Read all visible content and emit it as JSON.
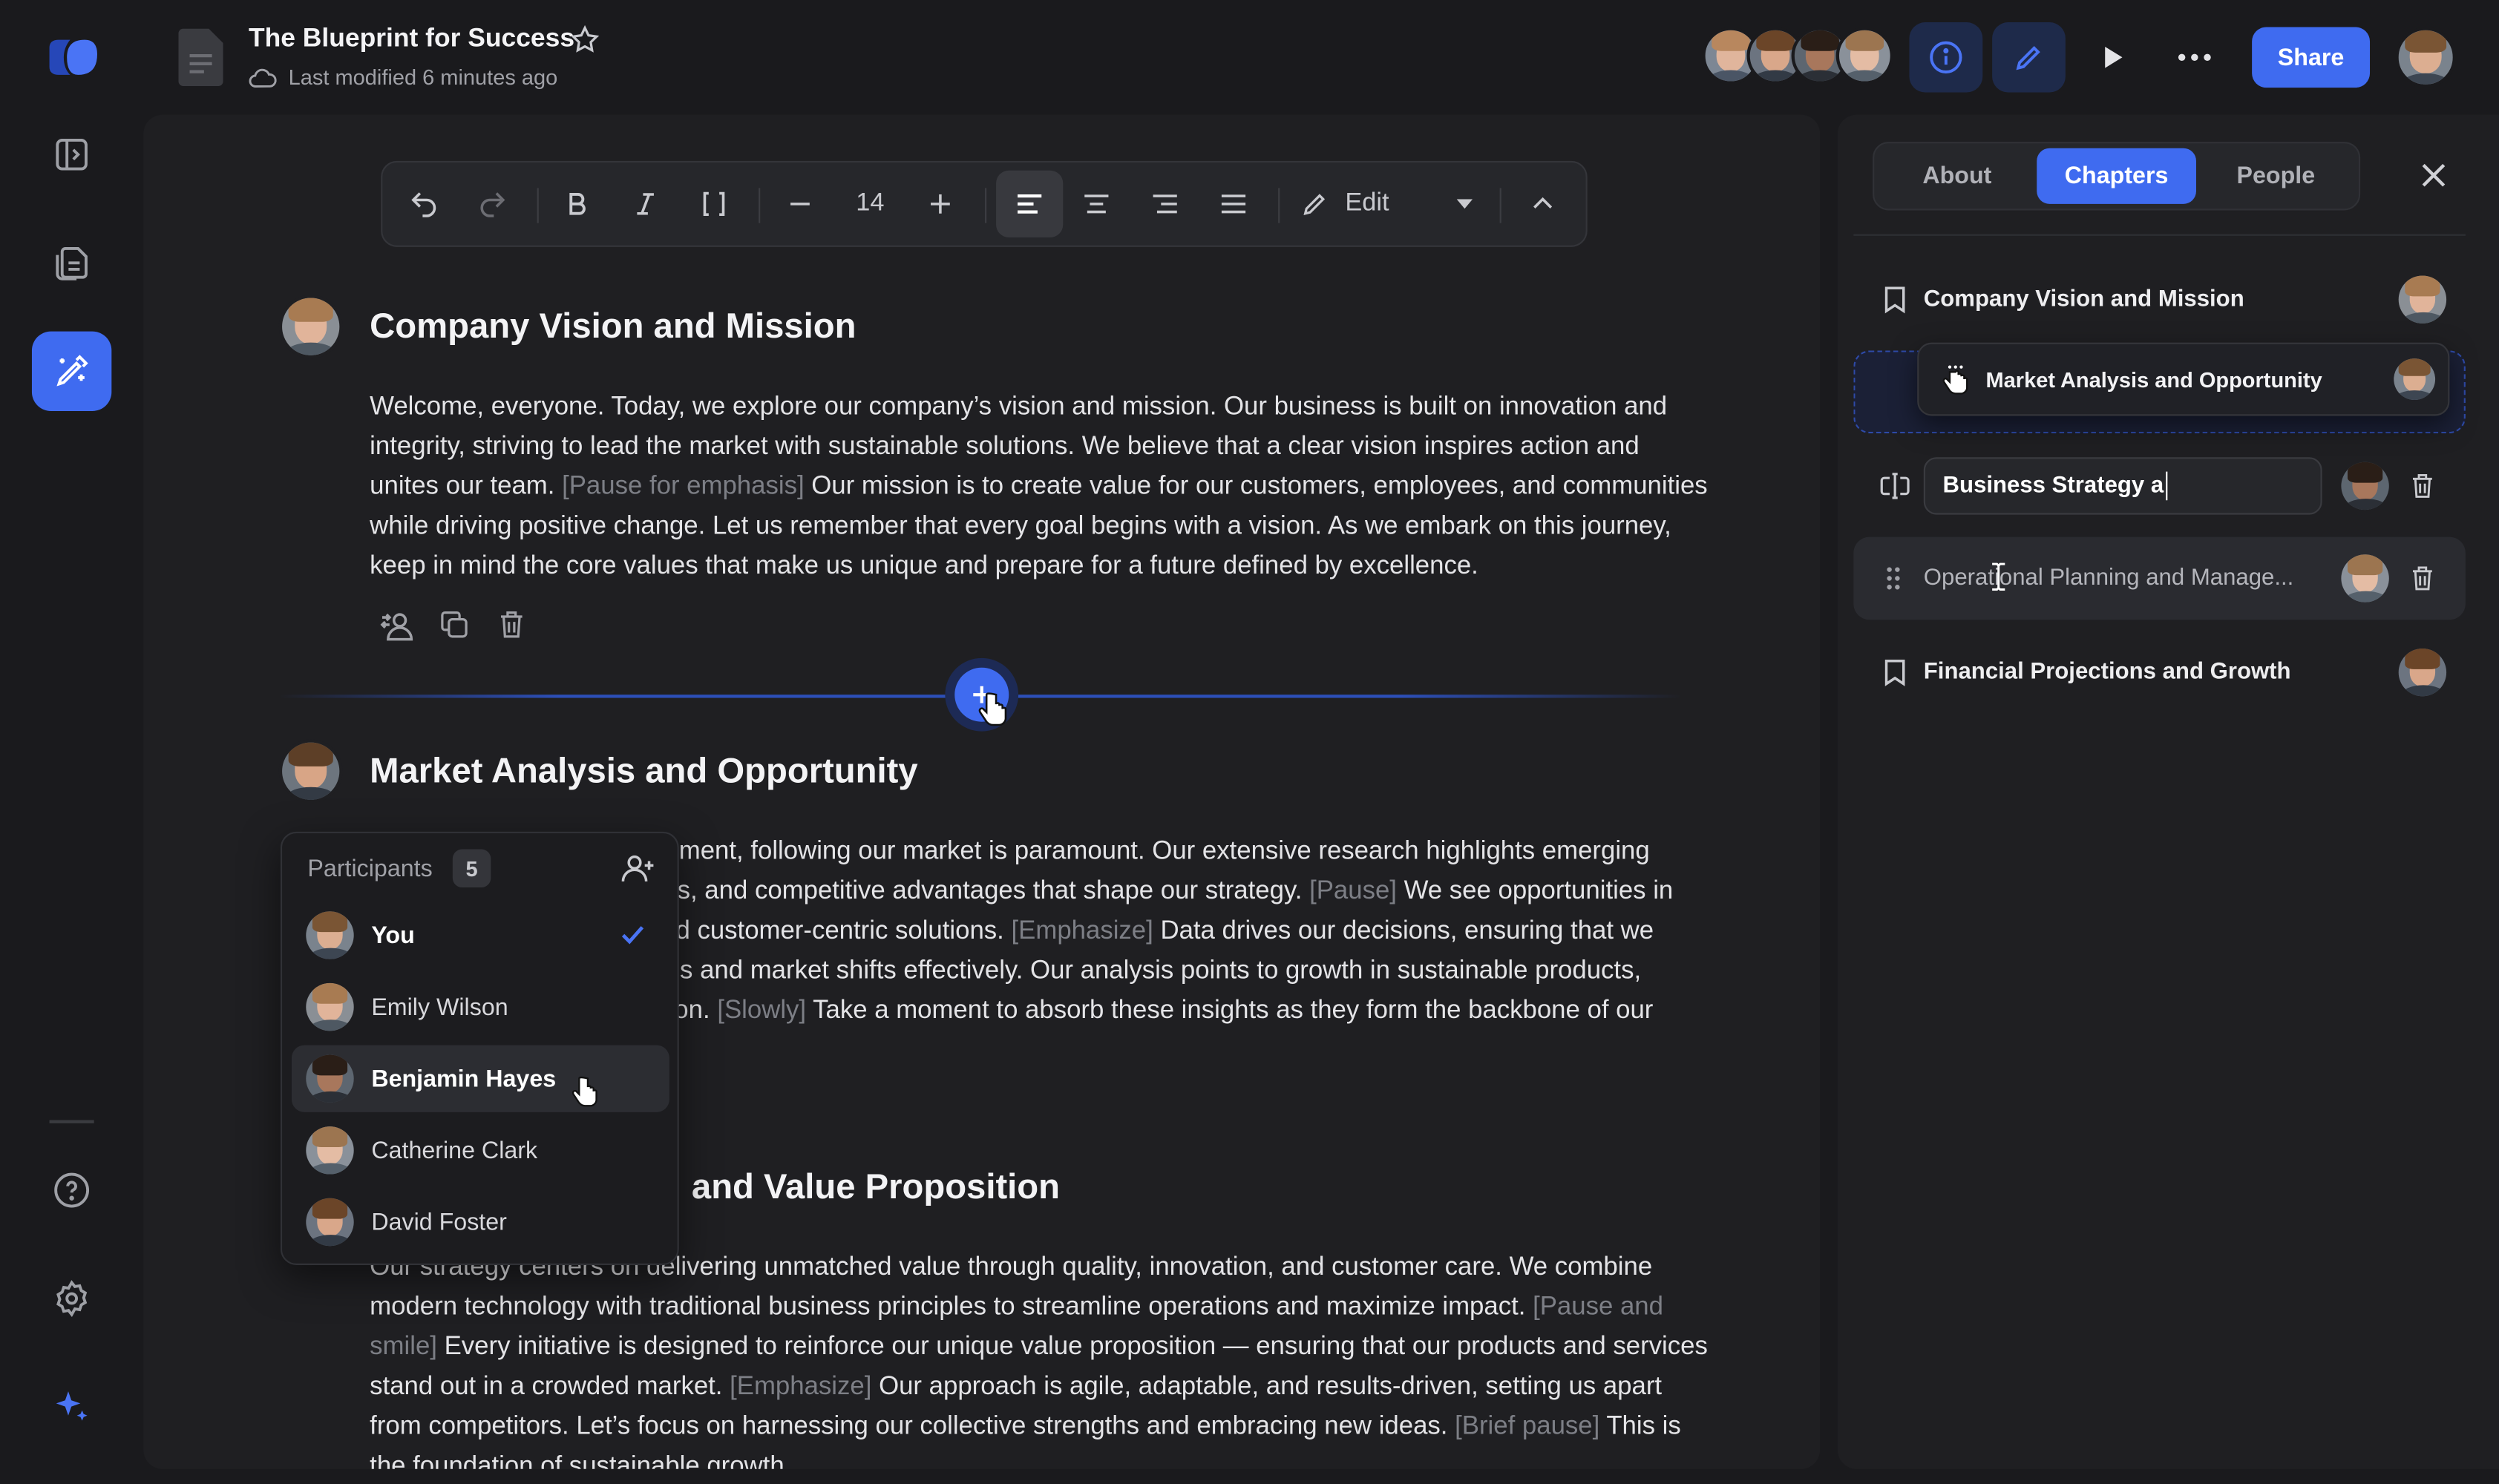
{
  "app": {
    "doc_title": "The Blueprint for Success",
    "last_modified": "Last modified 6 minutes ago",
    "share_label": "Share"
  },
  "toolbar": {
    "font_size": "14",
    "mode_label": "Edit"
  },
  "sections": [
    {
      "title": "Company Vision and Mission",
      "body": [
        {
          "t": "Welcome, everyone. Today, we explore our company’s vision and mission. Our business is built on innovation and integrity, striving to lead the market with sustainable solutions. We believe that a clear vision inspires action and unites our team. "
        },
        {
          "t": "[Pause for emphasis]",
          "cue": true
        },
        {
          "t": " Our mission is to create value for our customers, employees, and communities while driving positive change. Let us remember that every goal begins with a vision. As we embark on this journey, keep in mind the core values that make us unique and prepare for a future defined by excellence."
        }
      ]
    },
    {
      "title": "Market Analysis and Opportunity",
      "body_lines": [
        [
          {
            "t": "ment, following our market is paramount. Our extensive research highlights emerging"
          }
        ],
        [
          {
            "t": "s, and competitive advantages that shape our strategy. "
          },
          {
            "t": "[Pause]",
            "cue": true
          },
          {
            "t": " We see opportunities in"
          }
        ],
        [
          {
            "t": "d customer-centric solutions. "
          },
          {
            "t": "[Emphasize]",
            "cue": true
          },
          {
            "t": " Data drives our decisions, ensuring that we"
          }
        ],
        [
          {
            "t": "ls and market shifts effectively. Our analysis points to growth in sustainable products,"
          }
        ],
        [
          {
            "t": "on. "
          },
          {
            "t": "[Slowly]",
            "cue": true
          },
          {
            "t": " Take a moment to absorb these insights as they form the backbone of our"
          }
        ]
      ]
    },
    {
      "title": "and Value Proposition",
      "body_top_partial": "Our strategy centers on delivering unmatched value through quality, innovation, and customer care. We combine",
      "body": [
        {
          "t": "modern technology with traditional business principles to streamline operations and maximize impact. "
        },
        {
          "t": "[Pause and smile]",
          "cue": true
        },
        {
          "t": " Every initiative is designed to reinforce our unique value proposition — ensuring that our products and services stand out in a crowded market. "
        },
        {
          "t": "[Emphasize]",
          "cue": true
        },
        {
          "t": " Our approach is agile, adaptable, and results-driven, setting us apart from competitors. Let’s focus on harnessing our collective strengths and embracing new ideas. "
        },
        {
          "t": "[Brief pause]",
          "cue": true
        },
        {
          "t": " This is the foundation of sustainable growth."
        }
      ]
    }
  ],
  "participants": {
    "label": "Participants",
    "count": "5",
    "people": [
      {
        "name": "You",
        "selected": true
      },
      {
        "name": "Emily Wilson"
      },
      {
        "name": "Benjamin Hayes",
        "hovered": true
      },
      {
        "name": "Catherine Clark"
      },
      {
        "name": "David Foster"
      }
    ]
  },
  "panel": {
    "tabs": [
      "About",
      "Chapters",
      "People"
    ],
    "active_tab": "Chapters",
    "chapters": [
      {
        "title": "Company Vision and Mission"
      },
      {
        "title": "Market Analysis and Opportunity",
        "dragging": true
      },
      {
        "title": "Business Strategy a",
        "editing": true
      },
      {
        "title": "Operational Planning and Manage...",
        "hovered": true
      },
      {
        "title": "Financial Projections and Growth"
      }
    ]
  },
  "colors": {
    "accent": "#3f6bf0",
    "background": "#1a1a1d",
    "surface": "#202023",
    "cue_text": "#7d7f86"
  }
}
